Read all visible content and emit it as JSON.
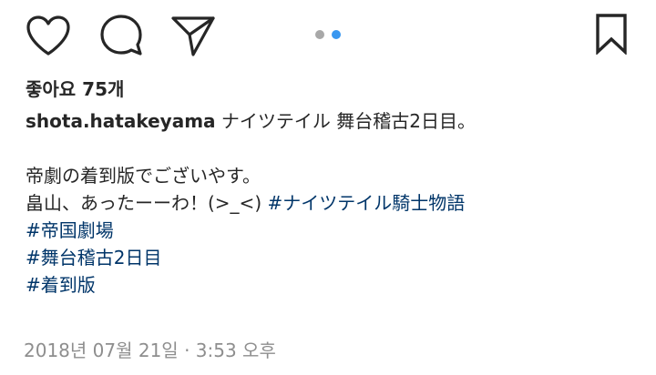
{
  "actions": {
    "like_icon": "heart-outline",
    "comment_icon": "speech-bubble",
    "share_icon": "paper-plane",
    "save_icon": "bookmark-outline"
  },
  "carousel": {
    "total": 2,
    "active_index": 1,
    "inactive_color": "#a8a8a8",
    "active_color": "#3897f0"
  },
  "likes": {
    "text": "좋아요 75개"
  },
  "caption": {
    "username": "shota.hatakeyama",
    "line1_text": " ナイツテイル 舞台稽古2日目。",
    "line2_text": "帝劇の着到版でございやす。",
    "line3_text": "畠山、あったーーわ！(>_<) ",
    "line3_hashtag": "#ナイツテイル騎士物語",
    "hashtag2": "#帝国劇場",
    "hashtag3": "#舞台稽古2日目",
    "hashtag4": "#着到版"
  },
  "timestamp": "2018년 07월 21일 · 3:53 오후",
  "colors": {
    "text": "#262626",
    "hashtag": "#003569",
    "muted": "#8e8e8e"
  }
}
